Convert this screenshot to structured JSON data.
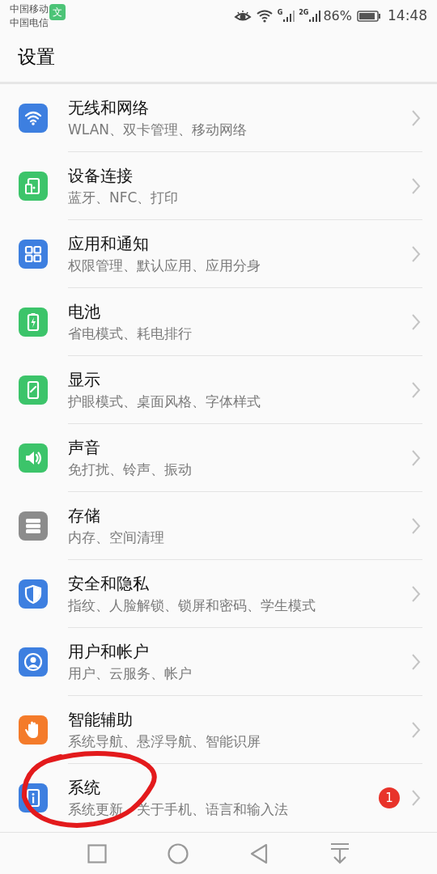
{
  "status_bar": {
    "carriers": [
      "中国移动",
      "中国电信"
    ],
    "app_badge": "文",
    "network_1": "G",
    "network_2": "2G",
    "battery": "86%",
    "time": "14:48"
  },
  "title": "设置",
  "items": [
    {
      "title": "无线和网络",
      "subtitle": "WLAN、双卡管理、移动网络",
      "color": "#3d7fe0"
    },
    {
      "title": "设备连接",
      "subtitle": "蓝牙、NFC、打印",
      "color": "#3cc46a"
    },
    {
      "title": "应用和通知",
      "subtitle": "权限管理、默认应用、应用分身",
      "color": "#3d7fe0"
    },
    {
      "title": "电池",
      "subtitle": "省电模式、耗电排行",
      "color": "#3cc46a"
    },
    {
      "title": "显示",
      "subtitle": "护眼模式、桌面风格、字体样式",
      "color": "#3cc46a"
    },
    {
      "title": "声音",
      "subtitle": "免打扰、铃声、振动",
      "color": "#3cc46a"
    },
    {
      "title": "存储",
      "subtitle": "内存、空间清理",
      "color": "#8c8c8c"
    },
    {
      "title": "安全和隐私",
      "subtitle": "指纹、人脸解锁、锁屏和密码、学生模式",
      "color": "#3d7fe0"
    },
    {
      "title": "用户和帐户",
      "subtitle": "用户、云服务、帐户",
      "color": "#3d7fe0"
    },
    {
      "title": "智能辅助",
      "subtitle": "系统导航、悬浮导航、智能识屏",
      "color": "#f47b2a"
    },
    {
      "title": "系统",
      "subtitle": "系统更新　关于手机、语言和输入法",
      "color": "#3d7fe0",
      "badge": "1"
    }
  ],
  "annotation": {
    "kind": "circle"
  }
}
